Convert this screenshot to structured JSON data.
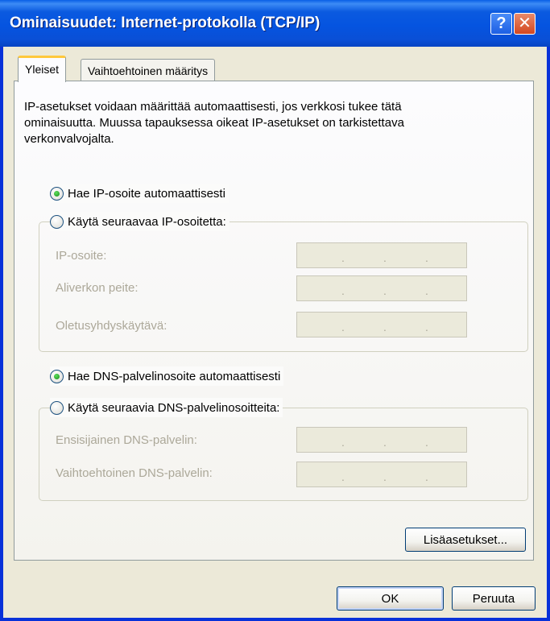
{
  "window": {
    "title": "Ominaisuudet: Internet-protokolla (TCP/IP)",
    "help_label": "?",
    "close_label": "✕"
  },
  "tabs": [
    {
      "label": "Yleiset",
      "selected": true
    },
    {
      "label": "Vaihtoehtoinen määritys",
      "selected": false
    }
  ],
  "intro": {
    "line1": "IP-asetukset voidaan määrittää automaattisesti, jos verkkosi tukee tätä",
    "line2": "ominaisuutta. Muussa tapauksessa oikeat IP-asetukset on tarkistettava",
    "line3": "verkonvalvojalta."
  },
  "ip": {
    "auto_label": "Hae IP-osoite automaattisesti",
    "auto_selected": true,
    "manual_label": "Käytä seuraavaa IP-osoitetta:",
    "manual_selected": false,
    "fields": [
      {
        "label": "IP-osoite:",
        "value": " .  .  . "
      },
      {
        "label": "Aliverkon peite:",
        "value": " .  .  . "
      },
      {
        "label": "Oletusyhdyskäytävä:",
        "value": " .  .  . "
      }
    ]
  },
  "dns": {
    "auto_label": "Hae DNS-palvelinosoite automaattisesti",
    "auto_selected": true,
    "manual_label": "Käytä seuraavia DNS-palvelinosoitteita:",
    "manual_selected": false,
    "fields": [
      {
        "label": "Ensisijainen DNS-palvelin:",
        "value": " .  .  . "
      },
      {
        "label": "Vaihtoehtoinen DNS-palvelin:",
        "value": " .  .  . "
      }
    ]
  },
  "buttons": {
    "advanced": "Lisäasetukset...",
    "ok": "OK",
    "cancel": "Peruuta"
  },
  "colors": {
    "titlebar": "#0554e0",
    "face": "#ece9d8",
    "disabled_text": "#aca899",
    "selected_tab_accent": "#ffc83c"
  }
}
